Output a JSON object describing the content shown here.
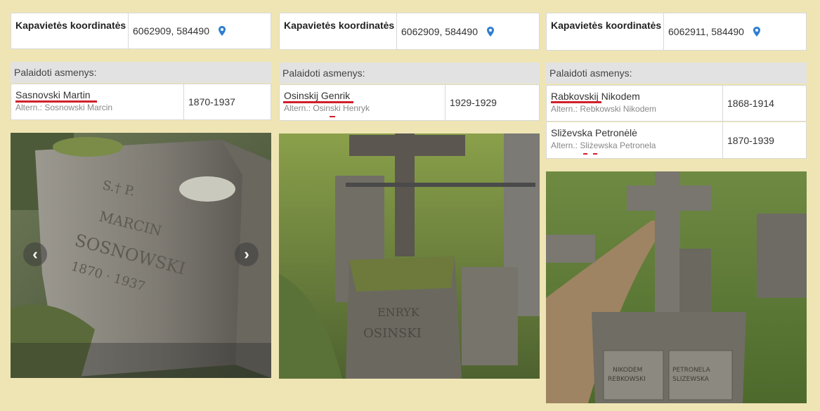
{
  "records": [
    {
      "coords_label": "Kapavietės koordinatės",
      "coords_value": "6062909, 584490",
      "buried_label": "Palaidoti asmenys:",
      "persons": [
        {
          "name": "Sasnovski Martin",
          "altern": "Altern.: Sosnowski Marcin",
          "years": "1870-1937"
        }
      ],
      "photo_icon": "grave-photo",
      "has_carousel": true
    },
    {
      "coords_label": "Kapavietės koordinatės",
      "coords_value": "6062909, 584490",
      "buried_label": "Palaidoti asmenys:",
      "persons": [
        {
          "name": "Osinskij Genrik",
          "altern": "Altern.: Osinski Henryk",
          "years": "1929-1929"
        }
      ],
      "photo_icon": "grave-photo",
      "has_carousel": false
    },
    {
      "coords_label": "Kapavietės koordinatės",
      "coords_value": "6062911, 584490",
      "buried_label": "Palaidoti asmenys:",
      "persons": [
        {
          "name": "Rabkovskij Nikodem",
          "altern": "Altern.: Rebkowski Nikodem",
          "years": "1868-1914"
        },
        {
          "name": "Sliževska Petronėlė",
          "altern": "Altern.: Sliżewska Petronela",
          "years": "1870-1939"
        }
      ],
      "photo_icon": "grave-photo",
      "has_carousel": false
    }
  ],
  "colors": {
    "background": "#efe5b4",
    "underline": "#d0202a",
    "pin": "#2f7fd0",
    "header_bg": "#e2e2e2"
  },
  "icons": {
    "pin": "map-pin-icon",
    "prev": "chevron-left-icon",
    "next": "chevron-right-icon"
  }
}
